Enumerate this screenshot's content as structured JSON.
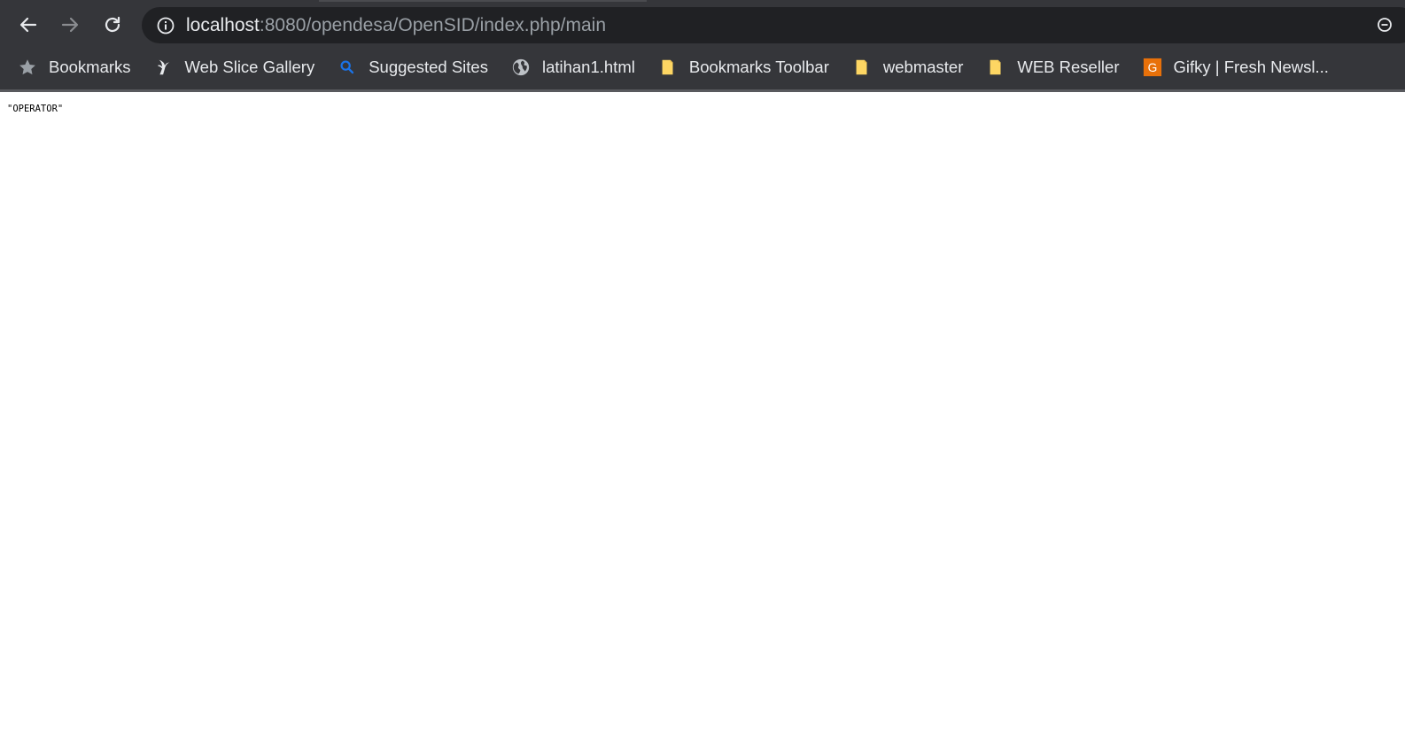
{
  "browser": {
    "url_host": "localhost",
    "url_path": ":8080/opendesa/OpenSID/index.php/main",
    "colors": {
      "chrome_bg": "#35363a",
      "omnibox_bg": "#202124",
      "text_primary": "#e8eaed",
      "text_secondary": "#9aa0a6"
    },
    "nav": {
      "back_icon": "arrow-left-icon",
      "forward_icon": "arrow-right-icon",
      "reload_icon": "reload-icon"
    }
  },
  "bookmarks": [
    {
      "label": "Bookmarks",
      "icon": "star-icon"
    },
    {
      "label": "Web Slice Gallery",
      "icon": "web-slice-icon"
    },
    {
      "label": "Suggested Sites",
      "icon": "search-icon"
    },
    {
      "label": "latihan1.html",
      "icon": "globe-icon"
    },
    {
      "label": "Bookmarks Toolbar",
      "icon": "folder-icon"
    },
    {
      "label": "webmaster",
      "icon": "folder-icon"
    },
    {
      "label": "WEB Reseller",
      "icon": "folder-icon"
    },
    {
      "label": "Gifky | Fresh Newsl...",
      "icon": "gifky-favicon",
      "favicon_letter": "G",
      "favicon_color": "#e8710a"
    }
  ],
  "page": {
    "response_text": "\"OPERATOR\""
  }
}
